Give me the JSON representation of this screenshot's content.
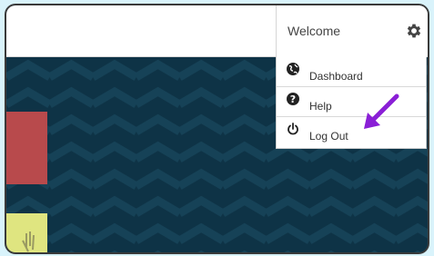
{
  "header": {
    "welcome_label": "Welcome",
    "settings_icon": "gear-icon"
  },
  "menu": {
    "items": [
      {
        "label": "Dashboard",
        "icon": "globe-icon"
      },
      {
        "label": "Help",
        "icon": "question-icon"
      },
      {
        "label": "Log Out",
        "icon": "power-icon"
      }
    ]
  },
  "annotation": {
    "arrow_color": "#8a1fd6"
  },
  "colors": {
    "background": "#0e3346",
    "page_bg": "#d9f3fb"
  }
}
